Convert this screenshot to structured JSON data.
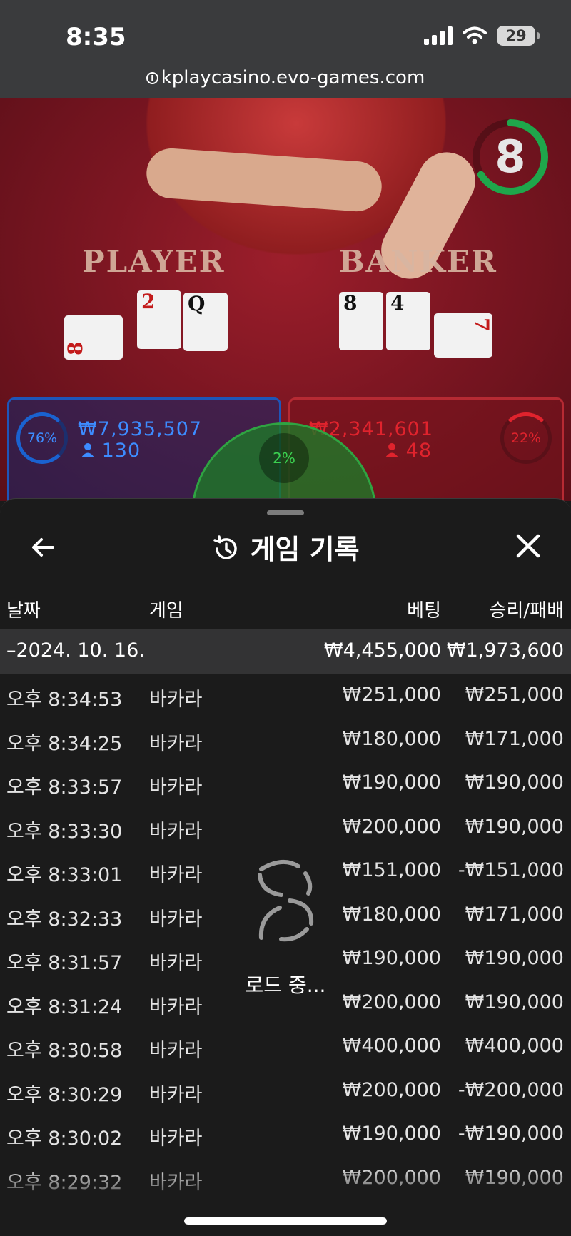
{
  "status_bar": {
    "time": "8:35",
    "battery": "29"
  },
  "browser": {
    "url": "kplaycasino.evo-games.com"
  },
  "table": {
    "player_label": "PLAYER",
    "banker_label": "BANKER",
    "timer": "8",
    "player_cards": [
      "8",
      "2",
      "Q"
    ],
    "banker_cards": [
      "8",
      "4",
      "7"
    ],
    "player_bet": {
      "percent": "76%",
      "amount": "₩7,935,507",
      "players": "130"
    },
    "banker_bet": {
      "percent": "22%",
      "amount": "₩2,341,601",
      "players": "48"
    },
    "tie_bet": {
      "percent": "2%"
    }
  },
  "history": {
    "title": "게임 기록",
    "columns": {
      "date": "날짜",
      "game": "게임",
      "bet": "베팅",
      "win_loss": "승리/패배"
    },
    "date_group": {
      "date": "–2024. 10. 16.",
      "total_bet": "₩4,455,000",
      "total_win_loss": "₩1,973,600"
    },
    "rows": [
      {
        "time": "오후 8:34:53",
        "game": "바카라",
        "bet": "₩251,000",
        "result": "₩251,000"
      },
      {
        "time": "오후 8:34:25",
        "game": "바카라",
        "bet": "₩180,000",
        "result": "₩171,000"
      },
      {
        "time": "오후 8:33:57",
        "game": "바카라",
        "bet": "₩190,000",
        "result": "₩190,000"
      },
      {
        "time": "오후 8:33:30",
        "game": "바카라",
        "bet": "₩200,000",
        "result": "₩190,000"
      },
      {
        "time": "오후 8:33:01",
        "game": "바카라",
        "bet": "₩151,000",
        "result": "-₩151,000"
      },
      {
        "time": "오후 8:32:33",
        "game": "바카라",
        "bet": "₩180,000",
        "result": "₩171,000"
      },
      {
        "time": "오후 8:31:57",
        "game": "바카라",
        "bet": "₩190,000",
        "result": "₩190,000"
      },
      {
        "time": "오후 8:31:24",
        "game": "바카라",
        "bet": "₩200,000",
        "result": "₩190,000"
      },
      {
        "time": "오후 8:30:58",
        "game": "바카라",
        "bet": "₩400,000",
        "result": "₩400,000"
      },
      {
        "time": "오후 8:30:29",
        "game": "바카라",
        "bet": "₩200,000",
        "result": "-₩200,000"
      },
      {
        "time": "오후 8:30:02",
        "game": "바카라",
        "bet": "₩190,000",
        "result": "-₩190,000"
      },
      {
        "time": "오후 8:29:32",
        "game": "바카라",
        "bet": "₩200,000",
        "result": "₩190,000"
      }
    ],
    "loading_text": "로드 중..."
  }
}
